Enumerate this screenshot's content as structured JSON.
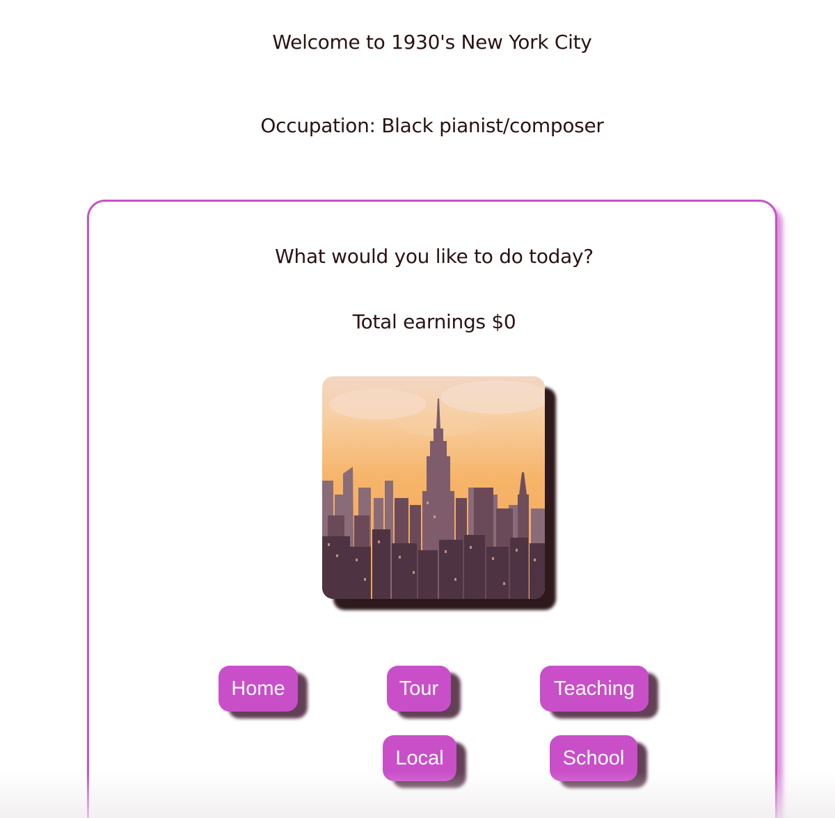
{
  "header": {
    "welcome": "Welcome to 1930's New York City",
    "occupation": "Occupation: Black pianist/composer"
  },
  "card": {
    "question": "What would you like to do today?",
    "earnings": "Total earnings $0",
    "image": {
      "icon": "new-york-skyline-image"
    },
    "buttons": {
      "home": "Home",
      "tour": "Tour",
      "teaching": "Teaching",
      "local": "Local",
      "school": "School"
    }
  },
  "colors": {
    "accent": "#c94fc9",
    "text": "#2a1212",
    "button_shadow": "#46203a",
    "image_shadow": "#2e1a1c"
  }
}
